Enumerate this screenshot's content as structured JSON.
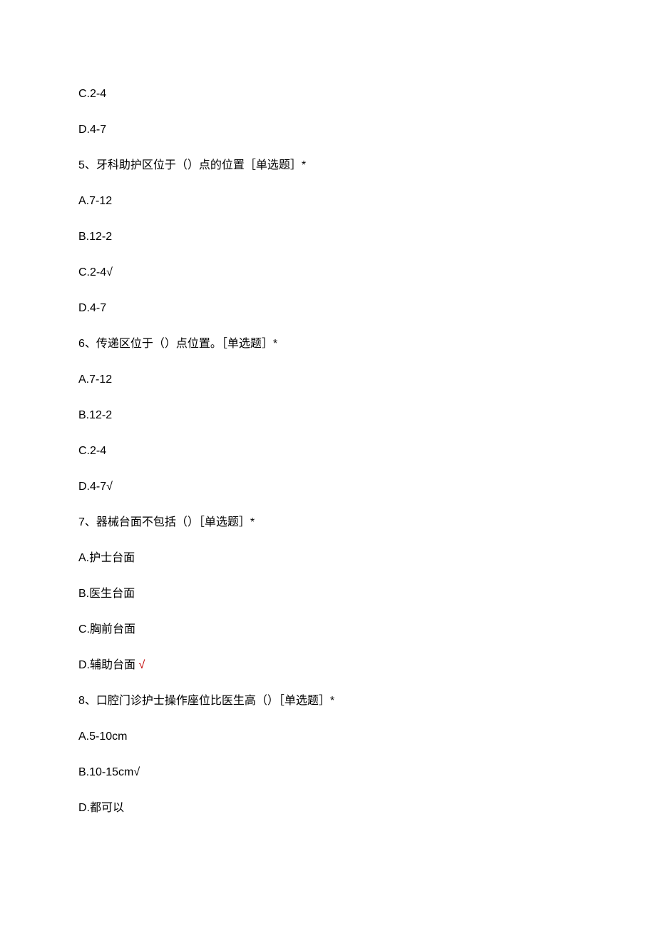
{
  "lines": [
    {
      "text": "C.2-4"
    },
    {
      "text": "D.4-7"
    },
    {
      "text": "5、牙科助护区位于（）点的位置［单选题］*"
    },
    {
      "text": "A.7-12"
    },
    {
      "text": "B.12-2"
    },
    {
      "text": "C.2-4√"
    },
    {
      "text": "D.4-7"
    },
    {
      "text": "6、传递区位于（）点位置。［单选题］*"
    },
    {
      "text": "A.7-12"
    },
    {
      "text": "B.12-2"
    },
    {
      "text": "C.2-4"
    },
    {
      "text": "D.4-7√"
    },
    {
      "text": "7、器械台面不包括（）［单选题］*"
    },
    {
      "text": "A.护士台面"
    },
    {
      "text": "B.医生台面"
    },
    {
      "text": "C.胸前台面"
    },
    {
      "prefix": "D.辅助台面 ",
      "mark": "√"
    },
    {
      "text": "8、口腔门诊护士操作座位比医生高（）［单选题］*"
    },
    {
      "text": "A.5-10cm"
    },
    {
      "text": "B.10-15cm√"
    },
    {
      "text": ""
    },
    {
      "text": "D.都可以"
    }
  ]
}
